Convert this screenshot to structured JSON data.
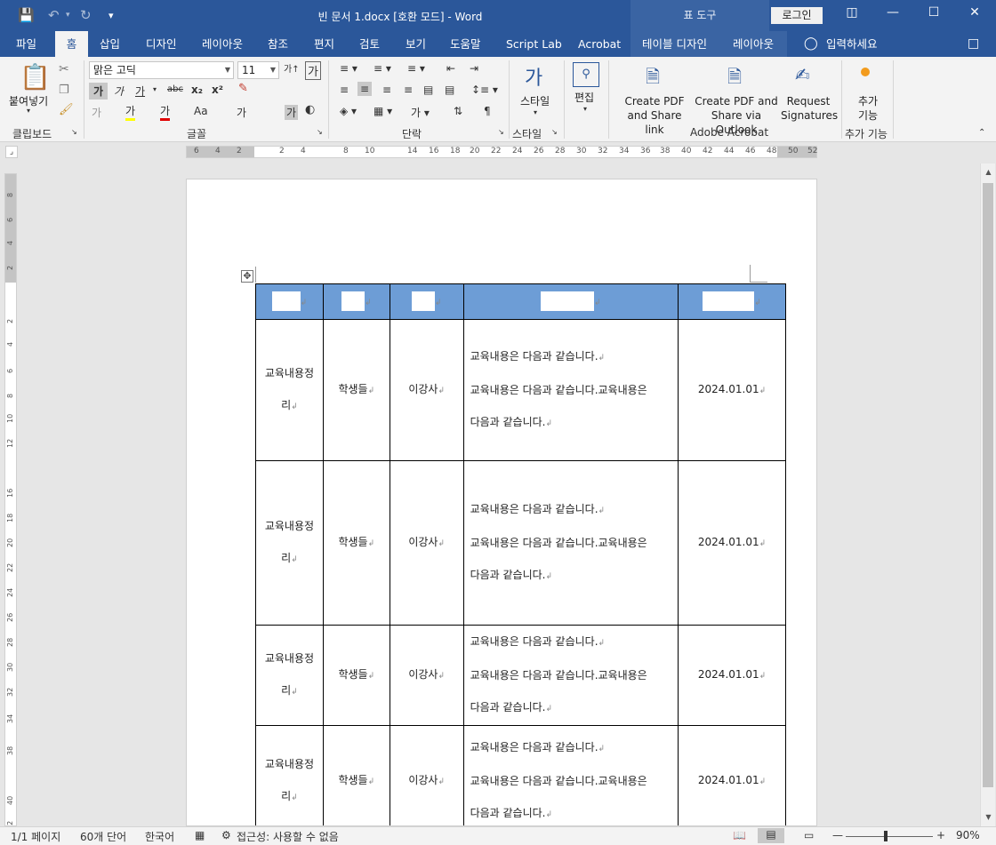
{
  "window": {
    "title": "빈 문서 1.docx [호환 모드]  -  Word",
    "context_header": "표 도구",
    "login_label": "로그인"
  },
  "tabs": [
    {
      "label": "파일"
    },
    {
      "label": "홈"
    },
    {
      "label": "삽입"
    },
    {
      "label": "디자인"
    },
    {
      "label": "레이아웃"
    },
    {
      "label": "참조"
    },
    {
      "label": "편지"
    },
    {
      "label": "검토"
    },
    {
      "label": "보기"
    },
    {
      "label": "도움말"
    },
    {
      "label": "Script Lab"
    },
    {
      "label": "Acrobat"
    },
    {
      "label": "테이블 디자인"
    },
    {
      "label": "레이아웃"
    },
    {
      "label": "입력하세요"
    }
  ],
  "ribbon": {
    "clipboard": {
      "paste": "붙여넣기",
      "label": "클립보드"
    },
    "font": {
      "name": "맑은 고딕",
      "size": "11",
      "label": "글꼴"
    },
    "paragraph": {
      "label": "단락"
    },
    "styles": {
      "button": "스타일",
      "label": "스타일"
    },
    "editing": {
      "button": "편집"
    },
    "acrobat": {
      "create_share_link": "Create PDF and Share link",
      "create_share_outlook": "Create PDF and Share via Outlook",
      "request_signatures": "Request Signatures",
      "label": "Adobe Acrobat"
    },
    "addins": {
      "button": "추가 기능",
      "label": "추가 기능"
    }
  },
  "ruler": {
    "h_ticks": [
      "6",
      "4",
      "2",
      "2",
      "4",
      "8",
      "10",
      "14",
      "16",
      "18",
      "20",
      "22",
      "24",
      "26",
      "28",
      "30",
      "32",
      "34",
      "36",
      "38",
      "40",
      "42",
      "44",
      "46",
      "48",
      "50",
      "52"
    ],
    "v_ticks": [
      "8",
      "6",
      "4",
      "2",
      "2",
      "4",
      "6",
      "8",
      "10",
      "12",
      "16",
      "18",
      "20",
      "22",
      "24",
      "26",
      "28",
      "30",
      "32",
      "34",
      "38",
      "40",
      "42"
    ]
  },
  "table": {
    "rows": [
      {
        "col1": "교육내용정리",
        "col2": "학생들",
        "col3": "이강사",
        "col4_lines": [
          "교육내용은 다음과 같습니다.",
          "교육내용은 다음과 같습니다.교육내용은",
          "다음과 같습니다."
        ],
        "col5": "2024.01.01"
      },
      {
        "col1": "교육내용정리",
        "col2": "학생들",
        "col3": "이강사",
        "col4_lines": [
          "교육내용은 다음과 같습니다.",
          "교육내용은 다음과 같습니다.교육내용은",
          "다음과 같습니다."
        ],
        "col5": "2024.01.01"
      },
      {
        "col1": "교육내용정리",
        "col2": "학생들",
        "col3": "이강사",
        "col4_lines": [
          "교육내용은 다음과 같습니다.",
          "교육내용은 다음과 같습니다.교육내용은",
          "다음과 같습니다."
        ],
        "col5": "2024.01.01"
      },
      {
        "col1": "교육내용정리",
        "col2": "학생들",
        "col3": "이강사",
        "col4_lines": [
          "교육내용은 다음과 같습니다.",
          "교육내용은 다음과 같습니다.교육내용은",
          "다음과 같습니다."
        ],
        "col5": "2024.01.01"
      }
    ],
    "header_color": "#6d9dd6"
  },
  "status": {
    "page": "1/1 페이지",
    "words": "60개 단어",
    "language": "한국어",
    "accessibility": "접근성: 사용할 수 없음",
    "zoom": "90%"
  },
  "colors": {
    "brand": "#2b579a"
  }
}
